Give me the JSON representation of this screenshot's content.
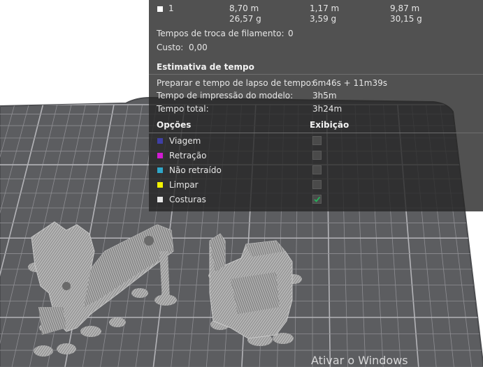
{
  "filament_table": {
    "row": {
      "label": "1",
      "col1": [
        "8,70 m",
        "26,57 g"
      ],
      "col2": [
        "1,17 m",
        "3,59 g"
      ],
      "col3": [
        "9,87 m",
        "30,15 g"
      ]
    }
  },
  "filament_changes": {
    "label": "Tempos de troca de filamento:",
    "value": "0"
  },
  "cost": {
    "label": "Custo:",
    "value": "0,00"
  },
  "time_estimate": {
    "title": "Estimativa de tempo",
    "rows": [
      {
        "label": "Preparar e tempo de lapso de tempo:",
        "value": "6m46s + 11m39s"
      },
      {
        "label": "Tempo de impressão do modelo:",
        "value": "3h5m"
      },
      {
        "label": "Tempo total:",
        "value": "3h24m"
      }
    ]
  },
  "options": {
    "header_left": "Opções",
    "header_right": "Exibição",
    "items": [
      {
        "label": "Viagem",
        "color": "#3f3fa6",
        "checked": false
      },
      {
        "label": "Retração",
        "color": "#d21bd2",
        "checked": false
      },
      {
        "label": "Não retraído",
        "color": "#2fa7c9",
        "checked": false
      },
      {
        "label": "Limpar",
        "color": "#f2f200",
        "checked": false
      },
      {
        "label": "Costuras",
        "color": "#e6e6e6",
        "checked": true
      }
    ]
  },
  "watermark": "Ativar o Windows",
  "colors": {
    "bed": "#5c5d60",
    "grid": "#8e8e92",
    "panel_bg": "rgba(38,38,38,0.8)",
    "check": "#26b35b"
  }
}
